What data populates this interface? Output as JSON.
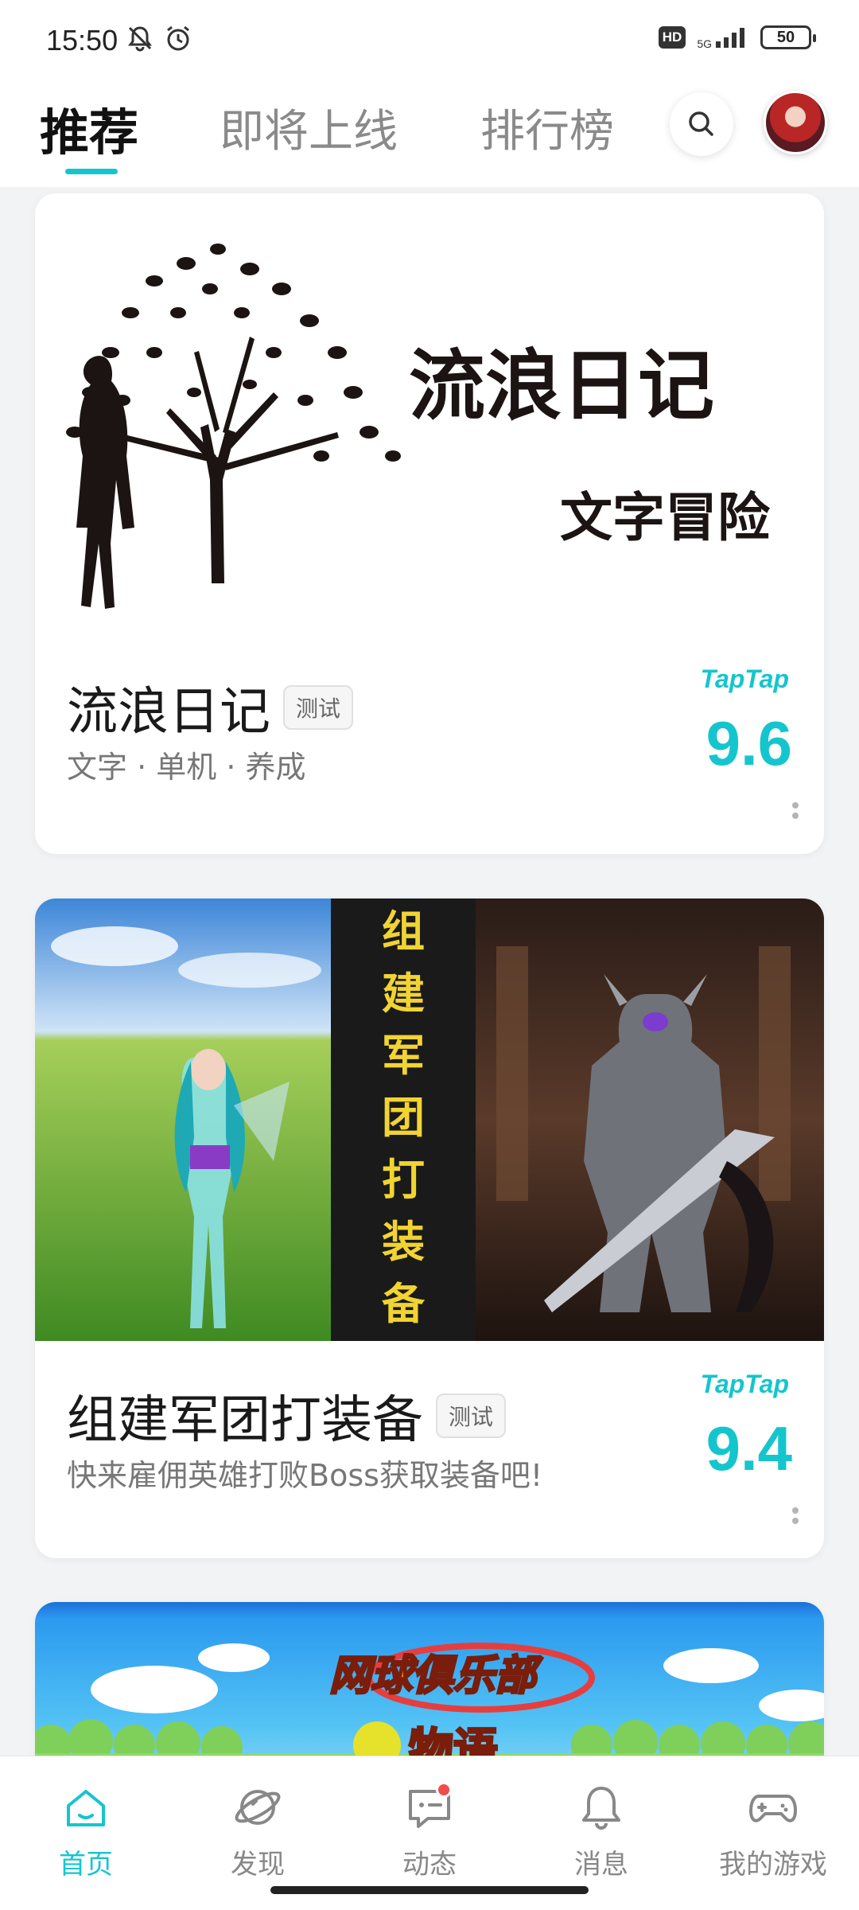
{
  "status_bar": {
    "time": "15:50",
    "hd": "HD",
    "network": "5G",
    "battery": "50"
  },
  "header": {
    "tabs": [
      {
        "label": "推荐",
        "active": true
      },
      {
        "label": "即将上线",
        "active": false
      },
      {
        "label": "排行榜",
        "active": false
      }
    ]
  },
  "cards": [
    {
      "banner_title": "流浪日记",
      "banner_subtitle": "文字冒险",
      "title": "流浪日记",
      "tag": "测试",
      "subtitle": "文字 · 单机 · 养成",
      "brand": "TapTap",
      "score": "9.6"
    },
    {
      "banner_text": [
        "组",
        "建",
        "军",
        "团",
        "打",
        "装",
        "备"
      ],
      "title": "组建军团打装备",
      "tag": "测试",
      "subtitle": "快来雇佣英雄打败Boss获取装备吧!",
      "brand": "TapTap",
      "score": "9.4"
    },
    {
      "banner_logo_line1": "网球俱乐部",
      "banner_logo_line2": "物语"
    }
  ],
  "bottom_nav": [
    {
      "label": "首页",
      "icon": "home-icon",
      "active": true
    },
    {
      "label": "发现",
      "icon": "discover-icon",
      "active": false
    },
    {
      "label": "动态",
      "icon": "feed-icon",
      "active": false
    },
    {
      "label": "消息",
      "icon": "bell-icon",
      "active": false
    },
    {
      "label": "我的游戏",
      "icon": "gamepad-icon",
      "active": false
    }
  ],
  "colors": {
    "accent": "#15c5ce",
    "badge": "#f24b4b"
  }
}
